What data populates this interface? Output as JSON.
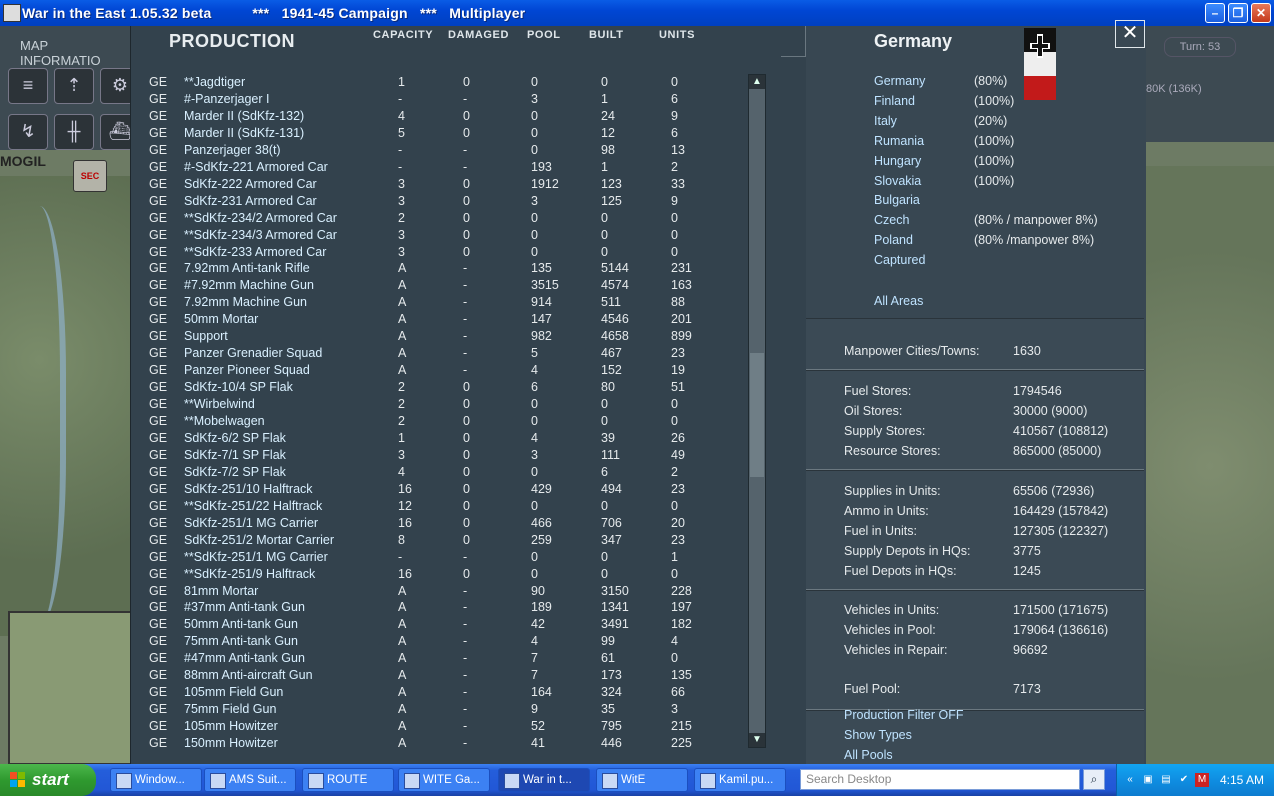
{
  "window": {
    "title": "War in the East 1.05.32 beta          ***   1941-45 Campaign   ***   Multiplayer",
    "min_label": "–",
    "max_label": "❐",
    "close_label": "✕"
  },
  "map": {
    "info_tab": "MAP INFORMATIO",
    "turn_label": "Turn: 53",
    "supply_text": "80K (136K)",
    "city_label": "MOGIL",
    "sec_tag": "SEC",
    "toolbar_icons": [
      "ship-icon",
      "units-icon",
      "gear-icon",
      "arrow-icon",
      "rail-icon",
      "ship2-icon"
    ]
  },
  "production": {
    "title": "PRODUCTION",
    "columns": {
      "capacity": "CAPACITY",
      "damaged": "DAMAGED",
      "pool": "POOL",
      "built": "BUILT",
      "units": "UNITS"
    },
    "rows": [
      {
        "nat": "GE",
        "name": "**Jagdtiger",
        "cap": "1",
        "dam": "0",
        "pool": "0",
        "built": "0",
        "units": "0"
      },
      {
        "nat": "GE",
        "name": "#-Panzerjager I",
        "cap": "-",
        "dam": "-",
        "pool": "3",
        "built": "1",
        "units": "6"
      },
      {
        "nat": "GE",
        "name": "Marder II (SdKfz-132)",
        "cap": "4",
        "dam": "0",
        "pool": "0",
        "built": "24",
        "units": "9"
      },
      {
        "nat": "GE",
        "name": "Marder II (SdKfz-131)",
        "cap": "5",
        "dam": "0",
        "pool": "0",
        "built": "12",
        "units": "6"
      },
      {
        "nat": "GE",
        "name": "Panzerjager 38(t)",
        "cap": "-",
        "dam": "-",
        "pool": "0",
        "built": "98",
        "units": "13"
      },
      {
        "nat": "GE",
        "name": "#-SdKfz-221 Armored Car",
        "cap": "-",
        "dam": "-",
        "pool": "193",
        "built": "1",
        "units": "2"
      },
      {
        "nat": "GE",
        "name": "SdKfz-222 Armored Car",
        "cap": "3",
        "dam": "0",
        "pool": "1912",
        "built": "123",
        "units": "33"
      },
      {
        "nat": "GE",
        "name": "SdKfz-231 Armored Car",
        "cap": "3",
        "dam": "0",
        "pool": "3",
        "built": "125",
        "units": "9"
      },
      {
        "nat": "GE",
        "name": "**SdKfz-234/2 Armored Car",
        "cap": "2",
        "dam": "0",
        "pool": "0",
        "built": "0",
        "units": "0"
      },
      {
        "nat": "GE",
        "name": "**SdKfz-234/3 Armored Car",
        "cap": "3",
        "dam": "0",
        "pool": "0",
        "built": "0",
        "units": "0"
      },
      {
        "nat": "GE",
        "name": "**SdKfz-233 Armored Car",
        "cap": "3",
        "dam": "0",
        "pool": "0",
        "built": "0",
        "units": "0"
      },
      {
        "nat": "GE",
        "name": "7.92mm Anti-tank Rifle",
        "cap": "A",
        "dam": "-",
        "pool": "135",
        "built": "5144",
        "units": "231"
      },
      {
        "nat": "GE",
        "name": "#7.92mm Machine Gun",
        "cap": "A",
        "dam": "-",
        "pool": "3515",
        "built": "4574",
        "units": "163"
      },
      {
        "nat": "GE",
        "name": "7.92mm Machine Gun",
        "cap": "A",
        "dam": "-",
        "pool": "914",
        "built": "511",
        "units": "88"
      },
      {
        "nat": "GE",
        "name": "50mm Mortar",
        "cap": "A",
        "dam": "-",
        "pool": "147",
        "built": "4546",
        "units": "201"
      },
      {
        "nat": "GE",
        "name": "Support",
        "cap": "A",
        "dam": "-",
        "pool": "982",
        "built": "4658",
        "units": "899"
      },
      {
        "nat": "GE",
        "name": "Panzer Grenadier Squad",
        "cap": "A",
        "dam": "-",
        "pool": "5",
        "built": "467",
        "units": "23"
      },
      {
        "nat": "GE",
        "name": "Panzer Pioneer Squad",
        "cap": "A",
        "dam": "-",
        "pool": "4",
        "built": "152",
        "units": "19"
      },
      {
        "nat": "GE",
        "name": "SdKfz-10/4 SP Flak",
        "cap": "2",
        "dam": "0",
        "pool": "6",
        "built": "80",
        "units": "51"
      },
      {
        "nat": "GE",
        "name": "**Wirbelwind",
        "cap": "2",
        "dam": "0",
        "pool": "0",
        "built": "0",
        "units": "0"
      },
      {
        "nat": "GE",
        "name": "**Mobelwagen",
        "cap": "2",
        "dam": "0",
        "pool": "0",
        "built": "0",
        "units": "0"
      },
      {
        "nat": "GE",
        "name": "SdKfz-6/2 SP Flak",
        "cap": "1",
        "dam": "0",
        "pool": "4",
        "built": "39",
        "units": "26"
      },
      {
        "nat": "GE",
        "name": "SdKfz-7/1 SP Flak",
        "cap": "3",
        "dam": "0",
        "pool": "3",
        "built": "111",
        "units": "49"
      },
      {
        "nat": "GE",
        "name": "SdKfz-7/2 SP Flak",
        "cap": "4",
        "dam": "0",
        "pool": "0",
        "built": "6",
        "units": "2"
      },
      {
        "nat": "GE",
        "name": "SdKfz-251/10 Halftrack",
        "cap": "16",
        "dam": "0",
        "pool": "429",
        "built": "494",
        "units": "23"
      },
      {
        "nat": "GE",
        "name": "**SdKfz-251/22 Halftrack",
        "cap": "12",
        "dam": "0",
        "pool": "0",
        "built": "0",
        "units": "0"
      },
      {
        "nat": "GE",
        "name": "SdKfz-251/1 MG Carrier",
        "cap": "16",
        "dam": "0",
        "pool": "466",
        "built": "706",
        "units": "20"
      },
      {
        "nat": "GE",
        "name": "SdKfz-251/2 Mortar Carrier",
        "cap": "8",
        "dam": "0",
        "pool": "259",
        "built": "347",
        "units": "23"
      },
      {
        "nat": "GE",
        "name": "**SdKfz-251/1 MG Carrier",
        "cap": "-",
        "dam": "-",
        "pool": "0",
        "built": "0",
        "units": "1"
      },
      {
        "nat": "GE",
        "name": "**SdKfz-251/9 Halftrack",
        "cap": "16",
        "dam": "0",
        "pool": "0",
        "built": "0",
        "units": "0"
      },
      {
        "nat": "GE",
        "name": "81mm Mortar",
        "cap": "A",
        "dam": "-",
        "pool": "90",
        "built": "3150",
        "units": "228"
      },
      {
        "nat": "GE",
        "name": "#37mm Anti-tank Gun",
        "cap": "A",
        "dam": "-",
        "pool": "189",
        "built": "1341",
        "units": "197"
      },
      {
        "nat": "GE",
        "name": "50mm Anti-tank Gun",
        "cap": "A",
        "dam": "-",
        "pool": "42",
        "built": "3491",
        "units": "182"
      },
      {
        "nat": "GE",
        "name": "75mm Anti-tank Gun",
        "cap": "A",
        "dam": "-",
        "pool": "4",
        "built": "99",
        "units": "4"
      },
      {
        "nat": "GE",
        "name": "#47mm Anti-tank Gun",
        "cap": "A",
        "dam": "-",
        "pool": "7",
        "built": "61",
        "units": "0"
      },
      {
        "nat": "GE",
        "name": "88mm Anti-aircraft Gun",
        "cap": "A",
        "dam": "-",
        "pool": "7",
        "built": "173",
        "units": "135"
      },
      {
        "nat": "GE",
        "name": "105mm Field Gun",
        "cap": "A",
        "dam": "-",
        "pool": "164",
        "built": "324",
        "units": "66"
      },
      {
        "nat": "GE",
        "name": "75mm Field Gun",
        "cap": "A",
        "dam": "-",
        "pool": "9",
        "built": "35",
        "units": "3"
      },
      {
        "nat": "GE",
        "name": "105mm Howitzer",
        "cap": "A",
        "dam": "-",
        "pool": "52",
        "built": "795",
        "units": "215"
      },
      {
        "nat": "GE",
        "name": "150mm Howitzer",
        "cap": "A",
        "dam": "-",
        "pool": "41",
        "built": "446",
        "units": "225"
      }
    ],
    "scroll_up": "▲",
    "scroll_down": "▼"
  },
  "country_panel": {
    "title": "Germany",
    "close_label": "✕",
    "areas": [
      {
        "name": "Germany",
        "pct": "(80%)"
      },
      {
        "name": "Finland",
        "pct": "(100%)"
      },
      {
        "name": "Italy",
        "pct": "(20%)"
      },
      {
        "name": "Rumania",
        "pct": "(100%)"
      },
      {
        "name": "Hungary",
        "pct": "(100%)"
      },
      {
        "name": "Slovakia",
        "pct": "(100%)"
      },
      {
        "name": "Bulgaria",
        "pct": ""
      },
      {
        "name": "Czech",
        "pct": "(80% / manpower 8%)"
      },
      {
        "name": "Poland",
        "pct": "(80% /manpower 8%)"
      },
      {
        "name": "Captured",
        "pct": ""
      }
    ],
    "all_areas": "All Areas",
    "manpower": {
      "label": "Manpower Cities/Towns:",
      "value": "1630"
    },
    "stores": [
      {
        "label": "Fuel Stores:",
        "value": "1794546"
      },
      {
        "label": "Oil Stores:",
        "value": "30000 (9000)"
      },
      {
        "label": "Supply Stores:",
        "value": "410567 (108812)"
      },
      {
        "label": "Resource Stores:",
        "value": "865000 (85000)"
      }
    ],
    "units_supply": [
      {
        "label": "Supplies in Units:",
        "value": "65506 (72936)"
      },
      {
        "label": "Ammo in Units:",
        "value": "164429 (157842)"
      },
      {
        "label": "Fuel in Units:",
        "value": "127305 (122327)"
      },
      {
        "label": "Supply Depots in HQs:",
        "value": "3775"
      },
      {
        "label": "Fuel Depots in HQs:",
        "value": "1245"
      }
    ],
    "vehicles": [
      {
        "label": "Vehicles in Units:",
        "value": "171500 (171675)"
      },
      {
        "label": "Vehicles in Pool:",
        "value": "179064 (136616)"
      },
      {
        "label": "Vehicles in Repair:",
        "value": "96692"
      }
    ],
    "fuel_pool": {
      "label": "Fuel Pool:",
      "value": "7173"
    },
    "links": {
      "filter": "Production Filter OFF",
      "types": "Show Types",
      "pools": "All Pools"
    }
  },
  "taskbar": {
    "start": "start",
    "tasks": [
      {
        "label": "Window...",
        "icon": "window-icon"
      },
      {
        "label": "AMS Suit...",
        "icon": "ams-icon"
      },
      {
        "label": "ROUTE",
        "icon": "route-icon"
      },
      {
        "label": "WITE Ga...",
        "icon": "wite-icon"
      },
      {
        "label": "War in t...",
        "icon": "war-icon"
      },
      {
        "label": "WitE",
        "icon": "folder-icon"
      },
      {
        "label": "Kamil.pu...",
        "icon": "doc-icon"
      }
    ],
    "search_placeholder": "Search Desktop",
    "clock": "4:15 AM"
  }
}
